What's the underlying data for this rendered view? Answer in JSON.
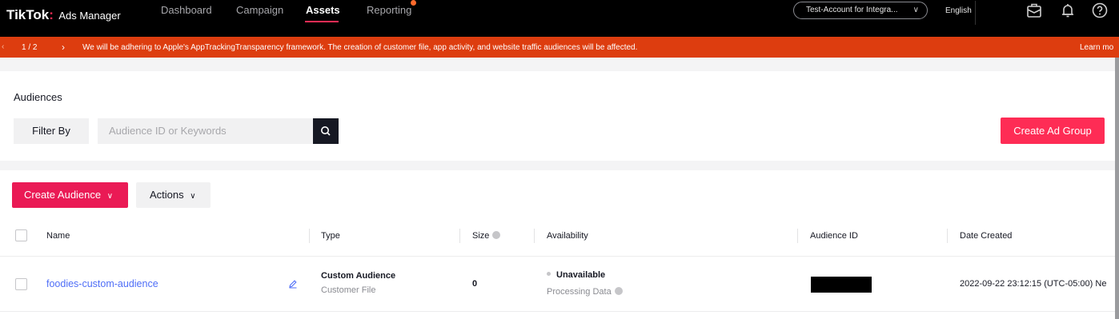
{
  "topnav": {
    "logo_text": "TikTok",
    "logo_colon": ":",
    "logo_sub": "Ads Manager",
    "items": [
      {
        "label": "Dashboard"
      },
      {
        "label": "Campaign"
      },
      {
        "label": "Assets"
      },
      {
        "label": "Reporting"
      }
    ],
    "active_item": "Assets",
    "account_label": "Test-Account for Integra...",
    "language": "English",
    "icons": [
      "briefcase-icon",
      "bell-icon",
      "help-icon"
    ]
  },
  "banner": {
    "page_indicator": "1 / 2",
    "message": "We will be adhering to Apple's AppTrackingTransparency framework. The creation of customer file, app activity, and website traffic audiences will be affected.",
    "link": "Learn mo"
  },
  "audiences_panel": {
    "title": "Audiences",
    "filter_label": "Filter By",
    "search_placeholder": "Audience ID or Keywords",
    "create_ad_group_label": "Create Ad Group"
  },
  "table_panel": {
    "create_audience_label": "Create Audience",
    "actions_label": "Actions",
    "columns": {
      "name": "Name",
      "type": "Type",
      "size": "Size",
      "availability": "Availability",
      "audience_id": "Audience ID",
      "date_created": "Date Created"
    },
    "rows": [
      {
        "name": "foodies-custom-audience",
        "type": "Custom Audience",
        "subtype": "Customer File",
        "size": "0",
        "availability": "Unavailable",
        "availability_detail": "Processing Data",
        "date_created": "2022-09-22 23:12:15 (UTC-05:00) Ne"
      }
    ]
  },
  "colors": {
    "brand_pink": "#fe2c55",
    "banner_orange": "#dd3d0f",
    "link_blue": "#4f6ef7"
  }
}
